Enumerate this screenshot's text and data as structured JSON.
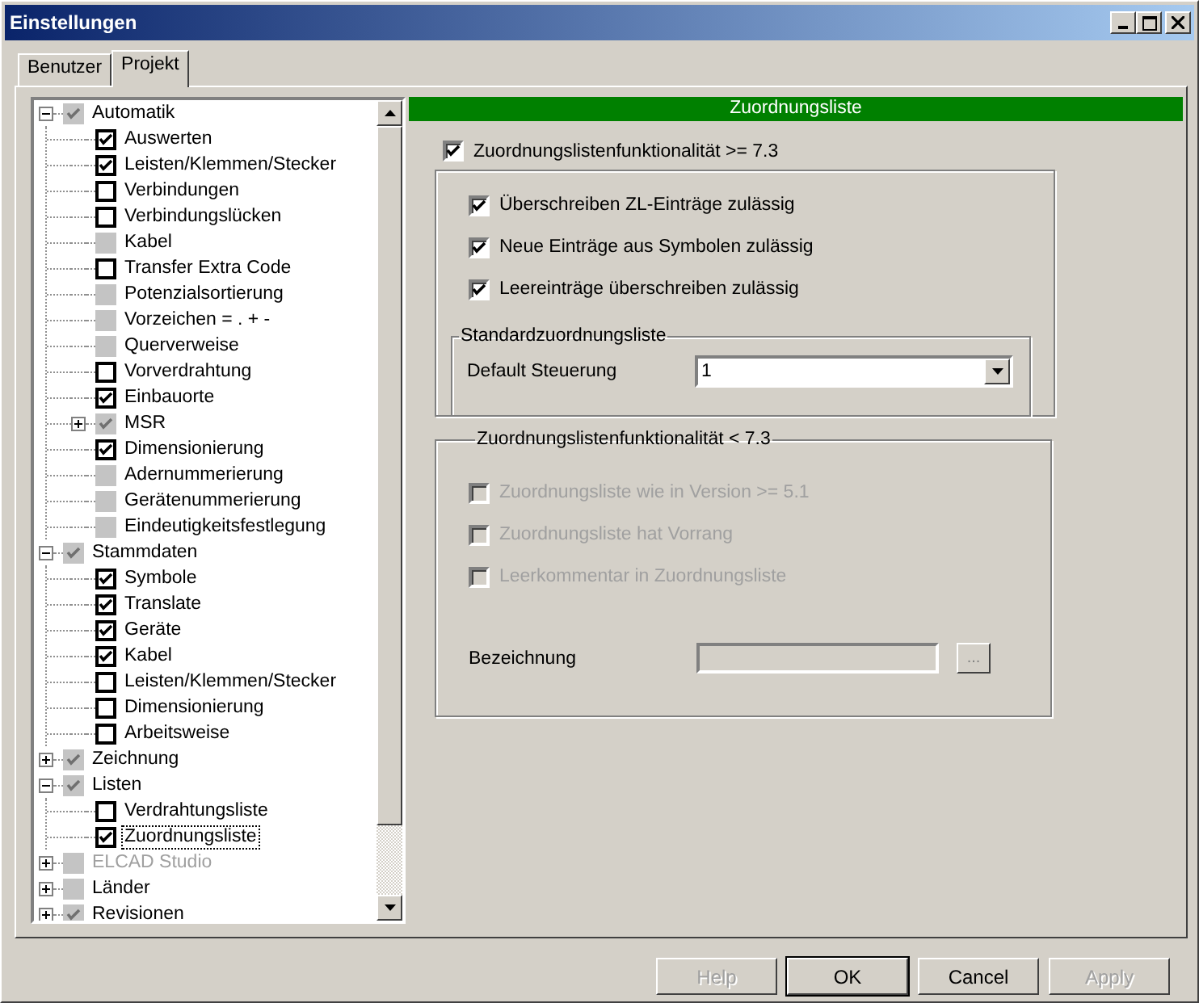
{
  "window": {
    "title": "Einstellungen"
  },
  "tabs": [
    {
      "label": "Benutzer",
      "selected": false
    },
    {
      "label": "Projekt",
      "selected": true
    }
  ],
  "tree": [
    {
      "label": "Automatik",
      "expanded": true,
      "checked": true,
      "box_disabled": true,
      "label_disabled": false,
      "selected": false,
      "children": [
        {
          "label": "Auswerten",
          "checked": true,
          "box_disabled": false,
          "label_disabled": false,
          "selected": false
        },
        {
          "label": "Leisten/Klemmen/Stecker",
          "checked": true,
          "box_disabled": false,
          "label_disabled": false,
          "selected": false
        },
        {
          "label": "Verbindungen",
          "checked": false,
          "box_disabled": false,
          "label_disabled": false,
          "selected": false
        },
        {
          "label": "Verbindungslücken",
          "checked": false,
          "box_disabled": false,
          "label_disabled": false,
          "selected": false
        },
        {
          "label": "Kabel",
          "checked": false,
          "box_disabled": true,
          "label_disabled": false,
          "selected": false
        },
        {
          "label": "Transfer Extra Code",
          "checked": false,
          "box_disabled": false,
          "label_disabled": false,
          "selected": false
        },
        {
          "label": "Potenzialsortierung",
          "checked": false,
          "box_disabled": true,
          "label_disabled": false,
          "selected": false
        },
        {
          "label": "Vorzeichen  =  .  +  -",
          "checked": false,
          "box_disabled": true,
          "label_disabled": false,
          "selected": false
        },
        {
          "label": "Querverweise",
          "checked": false,
          "box_disabled": true,
          "label_disabled": false,
          "selected": false
        },
        {
          "label": "Vorverdrahtung",
          "checked": false,
          "box_disabled": false,
          "label_disabled": false,
          "selected": false
        },
        {
          "label": "Einbauorte",
          "checked": true,
          "box_disabled": false,
          "label_disabled": false,
          "selected": false
        },
        {
          "label": "MSR",
          "expanded": false,
          "checked": true,
          "box_disabled": true,
          "label_disabled": false,
          "selected": false
        },
        {
          "label": "Dimensionierung",
          "checked": true,
          "box_disabled": false,
          "label_disabled": false,
          "selected": false
        },
        {
          "label": "Adernummerierung",
          "checked": false,
          "box_disabled": true,
          "label_disabled": false,
          "selected": false
        },
        {
          "label": "Gerätenummerierung",
          "checked": false,
          "box_disabled": true,
          "label_disabled": false,
          "selected": false
        },
        {
          "label": "Eindeutigkeitsfestlegung",
          "checked": false,
          "box_disabled": true,
          "label_disabled": false,
          "selected": false
        }
      ]
    },
    {
      "label": "Stammdaten",
      "expanded": true,
      "checked": true,
      "box_disabled": true,
      "label_disabled": false,
      "selected": false,
      "children": [
        {
          "label": "Symbole",
          "checked": true,
          "box_disabled": false,
          "label_disabled": false,
          "selected": false
        },
        {
          "label": "Translate",
          "checked": true,
          "box_disabled": false,
          "label_disabled": false,
          "selected": false
        },
        {
          "label": "Geräte",
          "checked": true,
          "box_disabled": false,
          "label_disabled": false,
          "selected": false
        },
        {
          "label": "Kabel",
          "checked": true,
          "box_disabled": false,
          "label_disabled": false,
          "selected": false
        },
        {
          "label": "Leisten/Klemmen/Stecker",
          "checked": false,
          "box_disabled": false,
          "label_disabled": false,
          "selected": false
        },
        {
          "label": "Dimensionierung",
          "checked": false,
          "box_disabled": false,
          "label_disabled": false,
          "selected": false
        },
        {
          "label": "Arbeitsweise",
          "checked": false,
          "box_disabled": false,
          "label_disabled": false,
          "selected": false
        }
      ]
    },
    {
      "label": "Zeichnung",
      "expanded": false,
      "checked": true,
      "box_disabled": true,
      "label_disabled": false,
      "selected": false
    },
    {
      "label": "Listen",
      "expanded": true,
      "checked": true,
      "box_disabled": true,
      "label_disabled": false,
      "selected": false,
      "children": [
        {
          "label": "Verdrahtungsliste",
          "checked": false,
          "box_disabled": false,
          "label_disabled": false,
          "selected": false
        },
        {
          "label": "Zuordnungsliste",
          "checked": true,
          "box_disabled": false,
          "label_disabled": false,
          "selected": true
        }
      ]
    },
    {
      "label": "ELCAD Studio",
      "expanded": false,
      "checked": false,
      "box_disabled": true,
      "label_disabled": true,
      "selected": false
    },
    {
      "label": "Länder",
      "expanded": false,
      "checked": false,
      "box_disabled": true,
      "label_disabled": false,
      "selected": false
    },
    {
      "label": "Revisionen",
      "expanded": false,
      "checked": true,
      "box_disabled": true,
      "label_disabled": false,
      "selected": false
    }
  ],
  "panel": {
    "header": "Zuordnungsliste",
    "main_option": {
      "label": "Zuordnungslistenfunktionalität >= 7.3",
      "checked": true,
      "disabled": false
    },
    "options": [
      {
        "label": "Überschreiben ZL-Einträge zulässig",
        "checked": true,
        "disabled": false
      },
      {
        "label": "Neue Einträge aus Symbolen zulässig",
        "checked": true,
        "disabled": false
      },
      {
        "label": "Leereinträge überschreiben zulässig",
        "checked": true,
        "disabled": false
      }
    ],
    "standard_group": {
      "title": "Standardzuordnungsliste",
      "field_label": "Default Steuerung",
      "value": "1"
    },
    "legacy_group": {
      "title": "Zuordnungslistenfunktionalität < 7.3",
      "options": [
        {
          "label": "Zuordnungsliste wie in Version >= 5.1",
          "checked": false,
          "disabled": true
        },
        {
          "label": "Zuordnungsliste hat Vorrang",
          "checked": false,
          "disabled": true
        },
        {
          "label": "Leerkommentar in Zuordnungsliste",
          "checked": false,
          "disabled": true
        }
      ],
      "field_label": "Bezeichnung",
      "field_disabled": true,
      "browse_label": "..."
    }
  },
  "buttons": [
    {
      "label": "Help",
      "disabled": true,
      "default": false
    },
    {
      "label": "OK",
      "disabled": false,
      "default": true
    },
    {
      "label": "Cancel",
      "disabled": false,
      "default": false
    },
    {
      "label": "Apply",
      "disabled": true,
      "default": false
    }
  ]
}
